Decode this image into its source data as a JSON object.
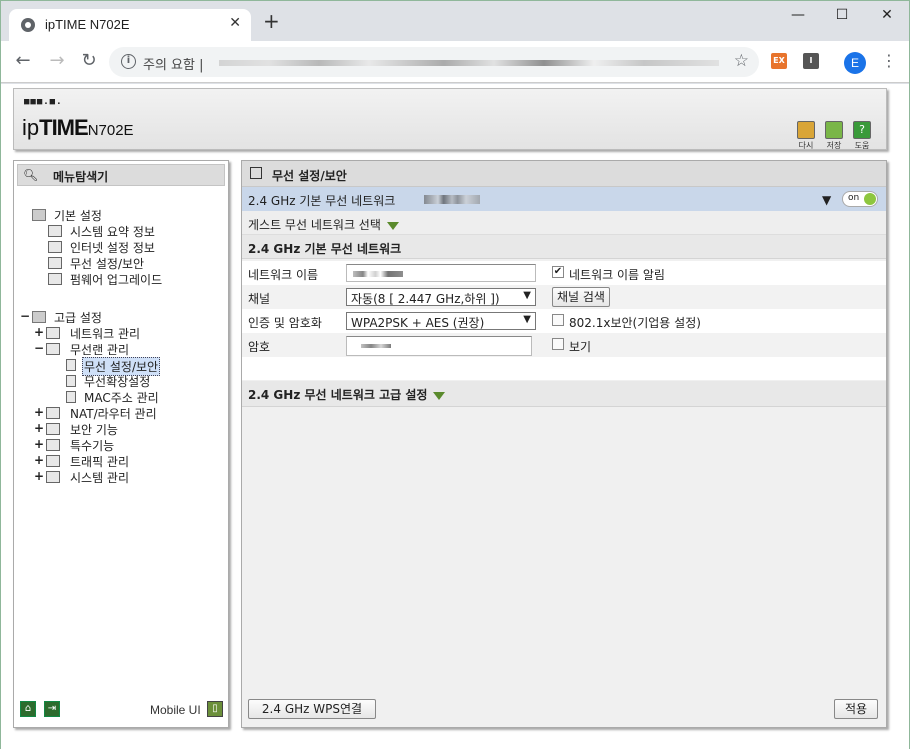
{
  "browser": {
    "tab_title": "ipTIME N702E",
    "tab_close": "✕",
    "new_tab": "+",
    "window_controls": [
      "—",
      "☐",
      "✕"
    ],
    "omnibox_warning": "주의 요함 |",
    "ext1": "EX",
    "ext2": "I",
    "profile_initial": "E"
  },
  "header": {
    "logo_dots": "■■■.■.",
    "logo_ip": "ip",
    "logo_time": "TIME",
    "logo_model": "N702E",
    "buttons": [
      {
        "label": "다시",
        "color": "#d9a537"
      },
      {
        "label": "저장",
        "color": "#7ab648"
      },
      {
        "label": "도움",
        "color": "#3a9a3a"
      }
    ]
  },
  "sidebar": {
    "title": "메뉴탐색기",
    "basic": {
      "label": "기본 설정",
      "items": [
        "시스템 요약 정보",
        "인터넷 설정 정보",
        "무선 설정/보안",
        "펌웨어 업그레이드"
      ]
    },
    "advanced": {
      "expander": "−",
      "label": "고급 설정",
      "items": [
        {
          "exp": "+",
          "label": "네트워크 관리"
        },
        {
          "exp": "−",
          "label": "무선랜 관리"
        },
        {
          "exp": "",
          "label": "무선 설정/보안",
          "level": 2,
          "selected": true
        },
        {
          "exp": "",
          "label": "무선확장설정",
          "level": 2
        },
        {
          "exp": "",
          "label": "MAC주소 관리",
          "level": 2
        },
        {
          "exp": "+",
          "label": "NAT/라우터 관리"
        },
        {
          "exp": "+",
          "label": "보안 기능"
        },
        {
          "exp": "+",
          "label": "특수기능"
        },
        {
          "exp": "+",
          "label": "트래픽 관리"
        },
        {
          "exp": "+",
          "label": "시스템 관리"
        }
      ]
    },
    "footer": {
      "home_icon": "⌂",
      "exit_icon": "⇥",
      "mobile_label": "Mobile UI",
      "mobile_icon": "▯"
    }
  },
  "panel": {
    "title": "무선 설정/보안",
    "network_bar_label": "2.4 GHz 기본 무선 네트워크",
    "toggle_label": "on",
    "guest_label": "게스트 무선 네트워크 선택",
    "section_basic": "2.4 GHz 기본 무선 네트워크",
    "rows": {
      "network_name_label": "네트워크 이름",
      "broadcast_label": "네트워크 이름 알림",
      "broadcast_checked": "✔",
      "channel_label": "채널",
      "channel_value": "자동(8 [ 2.447 GHz,하위 ])",
      "channel_search": "채널 검색",
      "auth_label": "인증 및 암호화",
      "auth_value": "WPA2PSK + AES (권장)",
      "enterprise_label": "802.1x보안(기업용 설정)",
      "password_label": "암호",
      "show_label": "보기"
    },
    "section_advanced": "2.4 GHz 무선 네트워크 고급 설정",
    "wps_button": "2.4 GHz WPS연결",
    "apply_button": "적용"
  }
}
